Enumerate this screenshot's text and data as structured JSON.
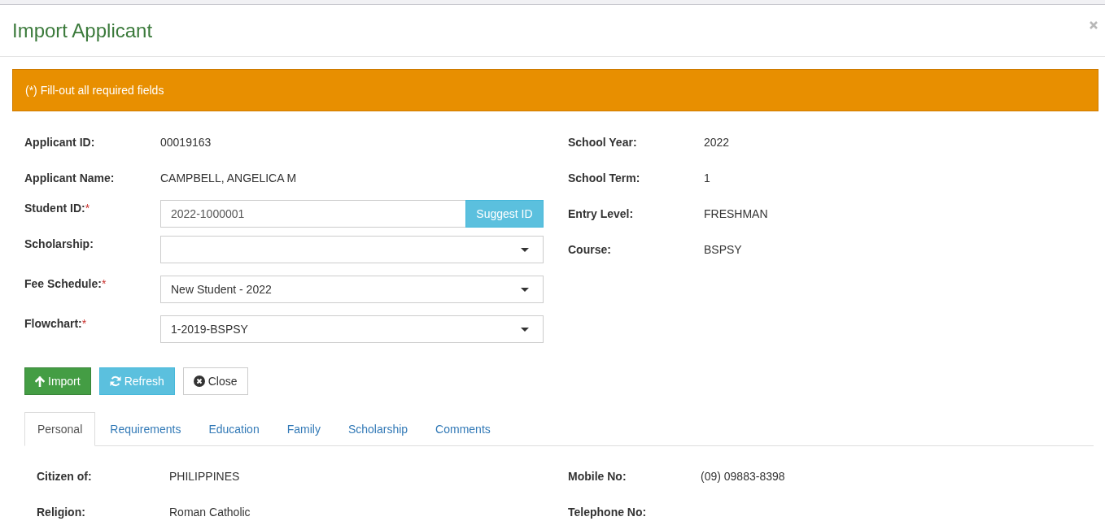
{
  "modal": {
    "title": "Import Applicant"
  },
  "alert": {
    "text": "(*) Fill-out all required fields"
  },
  "form": {
    "left": [
      {
        "kind": "text",
        "label": "Applicant ID:",
        "value": "00019163"
      },
      {
        "kind": "text",
        "label": "Applicant Name:",
        "value": "CAMPBELL, ANGELICA M"
      },
      {
        "kind": "input",
        "label": "Student ID:",
        "required_mark": "*",
        "value": "2022-1000001",
        "button": "Suggest ID"
      },
      {
        "kind": "select",
        "label": "Scholarship:"
      },
      {
        "kind": "select",
        "label": "Fee Schedule:",
        "required_mark": "*",
        "value": "New Student - 2022"
      },
      {
        "kind": "select",
        "label": "Flowchart:",
        "required_mark": "*",
        "value": "1-2019-BSPSY"
      }
    ],
    "right": [
      {
        "label": "School Year:",
        "value": "2022"
      },
      {
        "label": "School Term:",
        "value": "1"
      },
      {
        "label": "Entry Level:",
        "value": "FRESHMAN"
      },
      {
        "label": "Course:",
        "value": "BSPSY"
      }
    ]
  },
  "actions": [
    {
      "kind": "import",
      "label": "Import"
    },
    {
      "kind": "refresh",
      "label": "Refresh"
    },
    {
      "kind": "close",
      "label": "Close"
    }
  ],
  "tabs": [
    {
      "label": "Personal",
      "selected": true
    },
    {
      "label": "Requirements",
      "selected": false
    },
    {
      "label": "Education",
      "selected": false
    },
    {
      "label": "Family",
      "selected": false
    },
    {
      "label": "Scholarship",
      "selected": false
    },
    {
      "label": "Comments",
      "selected": false
    }
  ],
  "personal": {
    "left": [
      {
        "label": "Citizen of:",
        "value": "PHILIPPINES"
      },
      {
        "label": "Religion:",
        "value": "Roman Catholic"
      }
    ],
    "right": [
      {
        "label": "Mobile No:",
        "value": "(09) 09883-8398"
      },
      {
        "label": "Telephone No:"
      }
    ]
  }
}
